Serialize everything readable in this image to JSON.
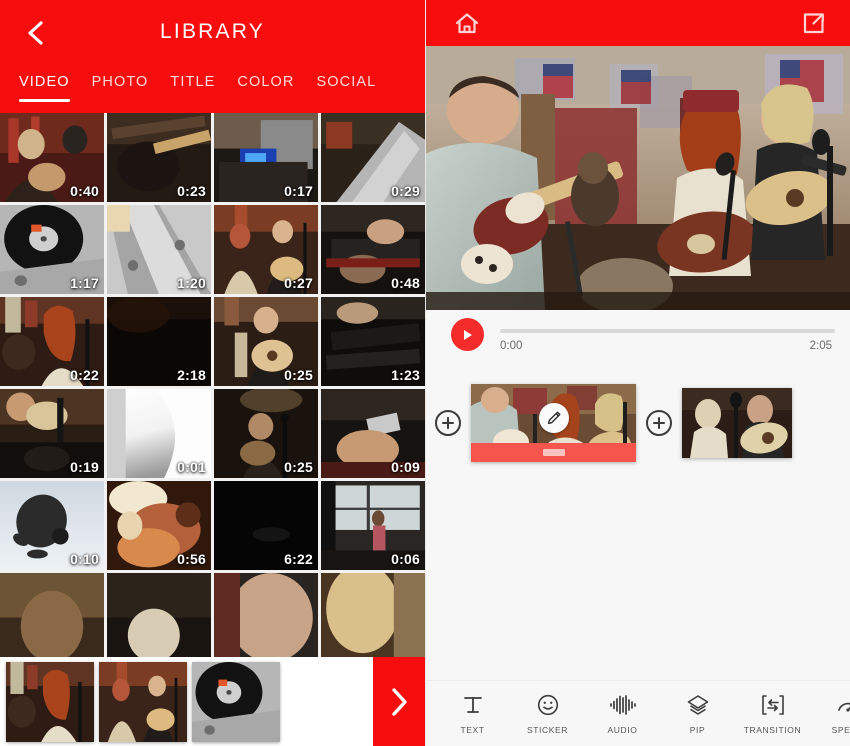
{
  "colors": {
    "brand_red": "#F70D0D",
    "play_red": "#F42B2B",
    "clip_bar_red": "#F5554D",
    "tab_inactive": "#FFD9D9",
    "panel_bg": "#F7F7F7"
  },
  "library": {
    "title": "LIBRARY",
    "back_icon": "chevron-left-icon",
    "tabs": [
      {
        "label": "VIDEO",
        "active": true
      },
      {
        "label": "PHOTO",
        "active": false
      },
      {
        "label": "TITLE",
        "active": false
      },
      {
        "label": "COLOR",
        "active": false
      },
      {
        "label": "SOCIAL",
        "active": false
      }
    ],
    "grid": [
      {
        "duration": "0:40",
        "scene": "band-guitar-red-room"
      },
      {
        "duration": "0:23",
        "scene": "guitar-neck-closeup"
      },
      {
        "duration": "0:17",
        "scene": "dj-mixer-blue-light"
      },
      {
        "duration": "0:29",
        "scene": "turntable-arm-silver"
      },
      {
        "duration": "1:17",
        "scene": "vinyl-record-platter"
      },
      {
        "duration": "1:20",
        "scene": "metal-deck-surface"
      },
      {
        "duration": "0:27",
        "scene": "duo-singing-stage"
      },
      {
        "duration": "0:48",
        "scene": "hands-on-equipment"
      },
      {
        "duration": "0:22",
        "scene": "redhead-singer-mic"
      },
      {
        "duration": "2:18",
        "scene": "dark-frame"
      },
      {
        "duration": "0:25",
        "scene": "acoustic-guitarist"
      },
      {
        "duration": "1:23",
        "scene": "mixer-desk-dark"
      },
      {
        "duration": "0:19",
        "scene": "guitarist-crowd"
      },
      {
        "duration": "0:01",
        "scene": "white-blur-frame"
      },
      {
        "duration": "0:25",
        "scene": "singer-spotlight"
      },
      {
        "duration": "0:09",
        "scene": "hand-holding-phone"
      },
      {
        "duration": "0:10",
        "scene": "skydiver-sky"
      },
      {
        "duration": "0:56",
        "scene": "hand-over-fire"
      },
      {
        "duration": "6:22",
        "scene": "black-frame"
      },
      {
        "duration": "0:06",
        "scene": "child-by-window"
      },
      {
        "duration": "",
        "scene": "partial-row-band"
      },
      {
        "duration": "",
        "scene": "partial-row-stage"
      },
      {
        "duration": "",
        "scene": "partial-row-hands"
      },
      {
        "duration": "",
        "scene": "partial-row-light"
      }
    ],
    "selected_clips": [
      {
        "scene": "redhead-singer-mic"
      },
      {
        "scene": "duo-singing-stage"
      },
      {
        "scene": "vinyl-record-platter"
      }
    ],
    "next_button": {
      "icon": "chevron-right-icon",
      "label": ""
    }
  },
  "editor": {
    "header": {
      "home_icon": "home-icon",
      "export_icon": "export-share-icon"
    },
    "preview": {
      "scene": "band-performing-bar-flags"
    },
    "transport": {
      "play_icon": "play-icon",
      "current_time": "0:00",
      "total_time": "2:05",
      "progress_percent": 0
    },
    "timeline": {
      "add_icon": "plus-circle-icon",
      "edit_icon": "pencil-edit-icon",
      "clips": [
        {
          "scene": "band-wide-shot",
          "selected": true
        },
        {
          "scene": "duo-acoustic",
          "selected": false
        }
      ]
    },
    "toolbar": [
      {
        "label": "TEXT",
        "icon": "text-t-icon"
      },
      {
        "label": "STICKER",
        "icon": "smiley-sticker-icon"
      },
      {
        "label": "AUDIO",
        "icon": "audio-waveform-icon"
      },
      {
        "label": "PIP",
        "icon": "layers-pip-icon"
      },
      {
        "label": "TRANSITION",
        "icon": "transition-arrows-icon"
      },
      {
        "label": "SPEED",
        "icon": "speedometer-icon"
      }
    ]
  }
}
